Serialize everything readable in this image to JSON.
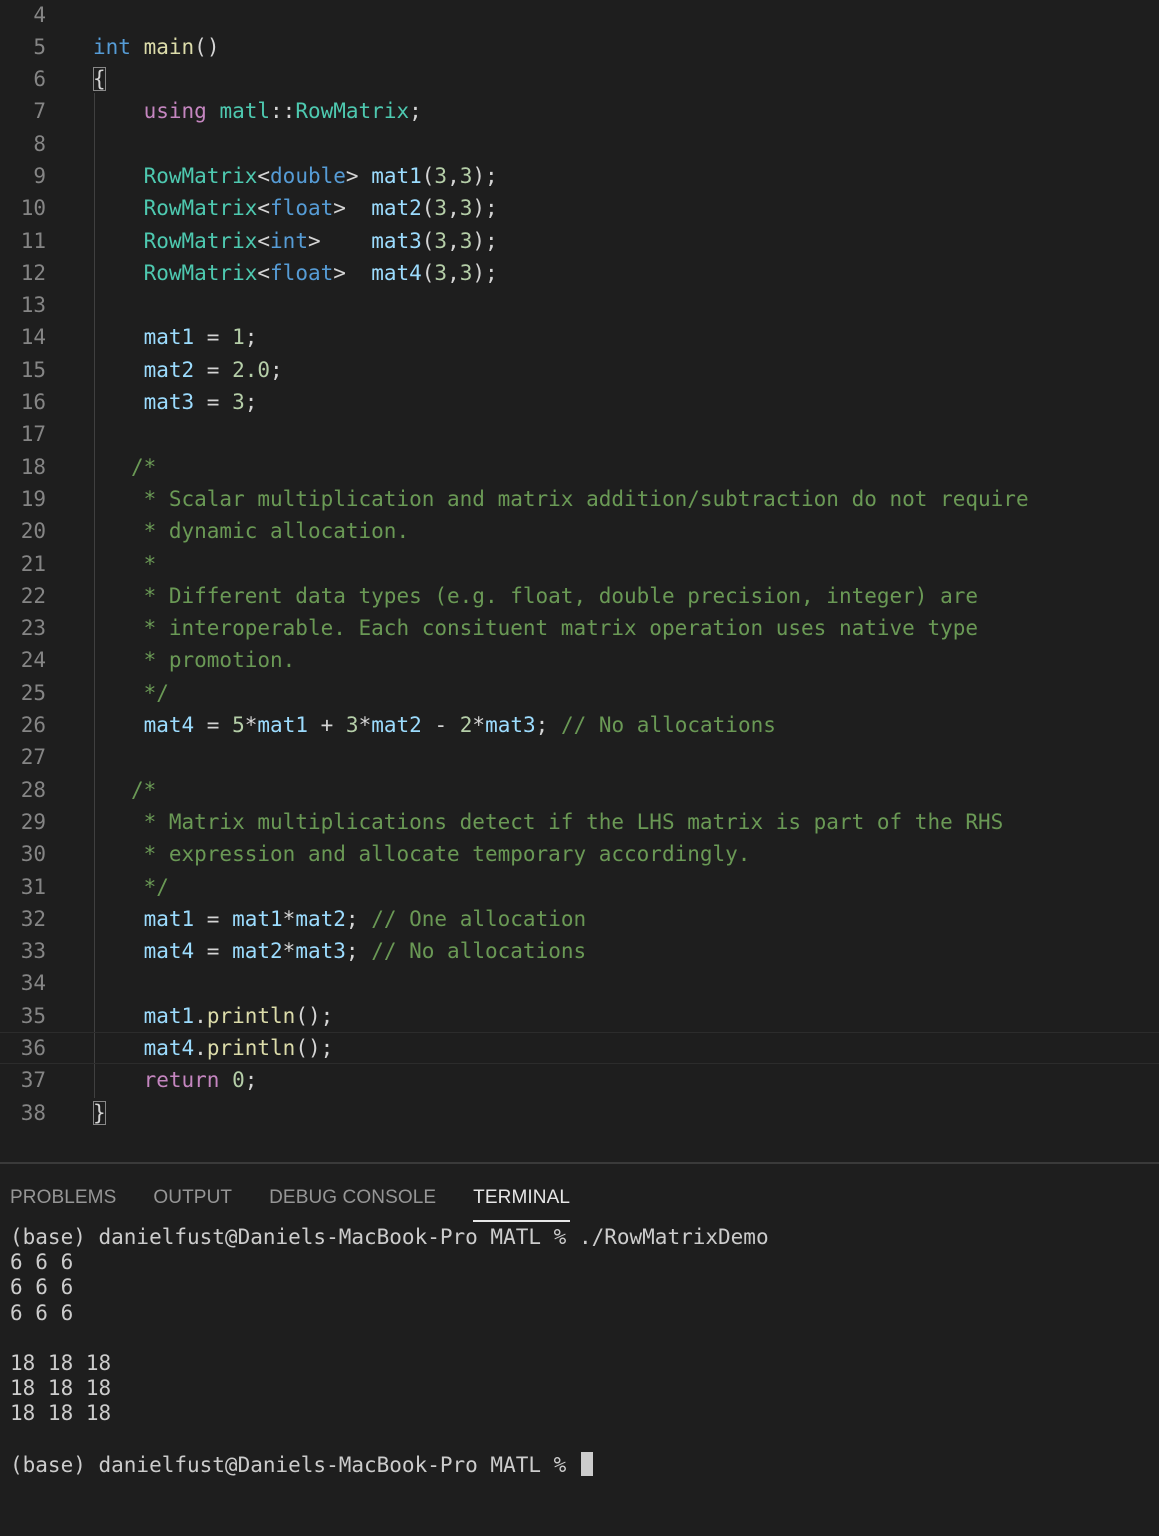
{
  "editor": {
    "lines": [
      {
        "n": "4",
        "tokens": []
      },
      {
        "n": "5",
        "tokens": [
          {
            "t": "int",
            "c": "kw"
          },
          {
            "t": " "
          },
          {
            "t": "main",
            "c": "fn"
          },
          {
            "t": "()"
          }
        ]
      },
      {
        "n": "6",
        "tokens": [
          {
            "t": "{",
            "c": "brace"
          }
        ]
      },
      {
        "n": "7",
        "tokens": [
          {
            "t": "    "
          },
          {
            "t": "using",
            "c": "ctl"
          },
          {
            "t": " "
          },
          {
            "t": "matl",
            "c": "type"
          },
          {
            "t": "::"
          },
          {
            "t": "RowMatrix",
            "c": "type"
          },
          {
            "t": ";"
          }
        ]
      },
      {
        "n": "8",
        "tokens": []
      },
      {
        "n": "9",
        "tokens": [
          {
            "t": "    "
          },
          {
            "t": "RowMatrix",
            "c": "type"
          },
          {
            "t": "<"
          },
          {
            "t": "double",
            "c": "kw"
          },
          {
            "t": "> "
          },
          {
            "t": "mat1",
            "c": "var"
          },
          {
            "t": "("
          },
          {
            "t": "3",
            "c": "num"
          },
          {
            "t": ","
          },
          {
            "t": "3",
            "c": "num"
          },
          {
            "t": ");"
          }
        ]
      },
      {
        "n": "10",
        "tokens": [
          {
            "t": "    "
          },
          {
            "t": "RowMatrix",
            "c": "type"
          },
          {
            "t": "<"
          },
          {
            "t": "float",
            "c": "kw"
          },
          {
            "t": ">  "
          },
          {
            "t": "mat2",
            "c": "var"
          },
          {
            "t": "("
          },
          {
            "t": "3",
            "c": "num"
          },
          {
            "t": ","
          },
          {
            "t": "3",
            "c": "num"
          },
          {
            "t": ");"
          }
        ]
      },
      {
        "n": "11",
        "tokens": [
          {
            "t": "    "
          },
          {
            "t": "RowMatrix",
            "c": "type"
          },
          {
            "t": "<"
          },
          {
            "t": "int",
            "c": "kw"
          },
          {
            "t": ">    "
          },
          {
            "t": "mat3",
            "c": "var"
          },
          {
            "t": "("
          },
          {
            "t": "3",
            "c": "num"
          },
          {
            "t": ","
          },
          {
            "t": "3",
            "c": "num"
          },
          {
            "t": ");"
          }
        ]
      },
      {
        "n": "12",
        "tokens": [
          {
            "t": "    "
          },
          {
            "t": "RowMatrix",
            "c": "type"
          },
          {
            "t": "<"
          },
          {
            "t": "float",
            "c": "kw"
          },
          {
            "t": ">  "
          },
          {
            "t": "mat4",
            "c": "var"
          },
          {
            "t": "("
          },
          {
            "t": "3",
            "c": "num"
          },
          {
            "t": ","
          },
          {
            "t": "3",
            "c": "num"
          },
          {
            "t": ");"
          }
        ]
      },
      {
        "n": "13",
        "tokens": []
      },
      {
        "n": "14",
        "tokens": [
          {
            "t": "    "
          },
          {
            "t": "mat1",
            "c": "var"
          },
          {
            "t": " = "
          },
          {
            "t": "1",
            "c": "num"
          },
          {
            "t": ";"
          }
        ]
      },
      {
        "n": "15",
        "tokens": [
          {
            "t": "    "
          },
          {
            "t": "mat2",
            "c": "var"
          },
          {
            "t": " = "
          },
          {
            "t": "2.0",
            "c": "num"
          },
          {
            "t": ";"
          }
        ]
      },
      {
        "n": "16",
        "tokens": [
          {
            "t": "    "
          },
          {
            "t": "mat3",
            "c": "var"
          },
          {
            "t": " = "
          },
          {
            "t": "3",
            "c": "num"
          },
          {
            "t": ";"
          }
        ]
      },
      {
        "n": "17",
        "tokens": []
      },
      {
        "n": "18",
        "tokens": [
          {
            "t": "   "
          },
          {
            "t": "/*",
            "c": "cmt"
          }
        ]
      },
      {
        "n": "19",
        "tokens": [
          {
            "t": "    "
          },
          {
            "t": "* Scalar multiplication and matrix addition/subtraction do not require",
            "c": "cmt"
          }
        ]
      },
      {
        "n": "20",
        "tokens": [
          {
            "t": "    "
          },
          {
            "t": "* dynamic allocation.",
            "c": "cmt"
          }
        ]
      },
      {
        "n": "21",
        "tokens": [
          {
            "t": "    "
          },
          {
            "t": "*",
            "c": "cmt"
          }
        ]
      },
      {
        "n": "22",
        "tokens": [
          {
            "t": "    "
          },
          {
            "t": "* Different data types (e.g. float, double precision, integer) are",
            "c": "cmt"
          }
        ]
      },
      {
        "n": "23",
        "tokens": [
          {
            "t": "    "
          },
          {
            "t": "* interoperable. Each consituent matrix operation uses native type",
            "c": "cmt"
          }
        ]
      },
      {
        "n": "24",
        "tokens": [
          {
            "t": "    "
          },
          {
            "t": "* promotion.",
            "c": "cmt"
          }
        ]
      },
      {
        "n": "25",
        "tokens": [
          {
            "t": "    "
          },
          {
            "t": "*/",
            "c": "cmt"
          }
        ]
      },
      {
        "n": "26",
        "tokens": [
          {
            "t": "    "
          },
          {
            "t": "mat4",
            "c": "var"
          },
          {
            "t": " = "
          },
          {
            "t": "5",
            "c": "num"
          },
          {
            "t": "*"
          },
          {
            "t": "mat1",
            "c": "var"
          },
          {
            "t": " + "
          },
          {
            "t": "3",
            "c": "num"
          },
          {
            "t": "*"
          },
          {
            "t": "mat2",
            "c": "var"
          },
          {
            "t": " - "
          },
          {
            "t": "2",
            "c": "num"
          },
          {
            "t": "*"
          },
          {
            "t": "mat3",
            "c": "var"
          },
          {
            "t": "; "
          },
          {
            "t": "// No allocations",
            "c": "cmt"
          }
        ]
      },
      {
        "n": "27",
        "tokens": []
      },
      {
        "n": "28",
        "tokens": [
          {
            "t": "   "
          },
          {
            "t": "/*",
            "c": "cmt"
          }
        ]
      },
      {
        "n": "29",
        "tokens": [
          {
            "t": "    "
          },
          {
            "t": "* Matrix multiplications detect if the LHS matrix is part of the RHS",
            "c": "cmt"
          }
        ]
      },
      {
        "n": "30",
        "tokens": [
          {
            "t": "    "
          },
          {
            "t": "* expression and allocate temporary accordingly.",
            "c": "cmt"
          }
        ]
      },
      {
        "n": "31",
        "tokens": [
          {
            "t": "    "
          },
          {
            "t": "*/",
            "c": "cmt"
          }
        ]
      },
      {
        "n": "32",
        "tokens": [
          {
            "t": "    "
          },
          {
            "t": "mat1",
            "c": "var"
          },
          {
            "t": " = "
          },
          {
            "t": "mat1",
            "c": "var"
          },
          {
            "t": "*"
          },
          {
            "t": "mat2",
            "c": "var"
          },
          {
            "t": "; "
          },
          {
            "t": "// One allocation",
            "c": "cmt"
          }
        ]
      },
      {
        "n": "33",
        "tokens": [
          {
            "t": "    "
          },
          {
            "t": "mat4",
            "c": "var"
          },
          {
            "t": " = "
          },
          {
            "t": "mat2",
            "c": "var"
          },
          {
            "t": "*"
          },
          {
            "t": "mat3",
            "c": "var"
          },
          {
            "t": "; "
          },
          {
            "t": "// No allocations",
            "c": "cmt"
          }
        ]
      },
      {
        "n": "34",
        "tokens": []
      },
      {
        "n": "35",
        "tokens": [
          {
            "t": "    "
          },
          {
            "t": "mat1",
            "c": "var"
          },
          {
            "t": "."
          },
          {
            "t": "println",
            "c": "fn"
          },
          {
            "t": "();"
          }
        ]
      },
      {
        "n": "36",
        "tokens": [
          {
            "t": "    "
          },
          {
            "t": "mat4",
            "c": "var"
          },
          {
            "t": "."
          },
          {
            "t": "println",
            "c": "fn"
          },
          {
            "t": "();"
          }
        ],
        "current": true
      },
      {
        "n": "37",
        "tokens": [
          {
            "t": "    "
          },
          {
            "t": "return",
            "c": "ctl"
          },
          {
            "t": " "
          },
          {
            "t": "0",
            "c": "num"
          },
          {
            "t": ";"
          }
        ]
      },
      {
        "n": "38",
        "tokens": [
          {
            "t": "}",
            "c": "brace"
          }
        ]
      }
    ]
  },
  "panel": {
    "tabs": [
      "PROBLEMS",
      "OUTPUT",
      "DEBUG CONSOLE",
      "TERMINAL"
    ],
    "active_tab": "TERMINAL"
  },
  "terminal": {
    "lines": [
      "(base) danielfust@Daniels-MacBook-Pro MATL % ./RowMatrixDemo",
      "6 6 6",
      "6 6 6",
      "6 6 6",
      "",
      "18 18 18",
      "18 18 18",
      "18 18 18",
      "",
      "(base) danielfust@Daniels-MacBook-Pro MATL % "
    ]
  }
}
